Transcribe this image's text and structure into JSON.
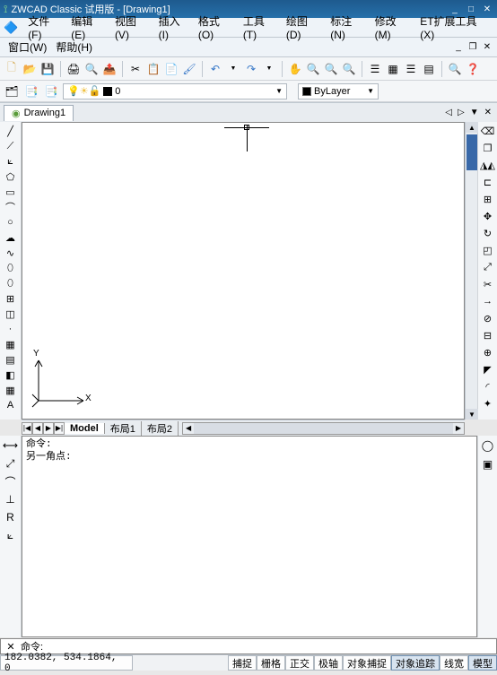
{
  "title": "ZWCAD Classic 试用版 - [Drawing1]",
  "menus": {
    "file": "文件(F)",
    "edit": "编辑(E)",
    "view": "视图(V)",
    "insert": "插入(I)",
    "format": "格式(O)",
    "tools": "工具(T)",
    "draw": "绘图(D)",
    "dimension": "标注(N)",
    "modify": "修改(M)",
    "et": "ET扩展工具(X)",
    "window": "窗口(W)",
    "help": "帮助(H)"
  },
  "layer": {
    "current": "0",
    "linetype": "ByLayer"
  },
  "doc_tab": "Drawing1",
  "model_tabs": {
    "model": "Model",
    "layout1": "布局1",
    "layout2": "布局2"
  },
  "cmd_history": {
    "l1": "命令:",
    "l2": "另一角点:"
  },
  "cmd_prompt": "命令:",
  "status": {
    "coords": "182.0382, 534.1864, 0",
    "snap": "捕捉",
    "grid": "栅格",
    "ortho": "正交",
    "polar": "极轴",
    "osnap": "对象捕捉",
    "otrack": "对象追踪",
    "lwt": "线宽",
    "model": "模型"
  },
  "ucs": {
    "x": "X",
    "y": "Y"
  }
}
